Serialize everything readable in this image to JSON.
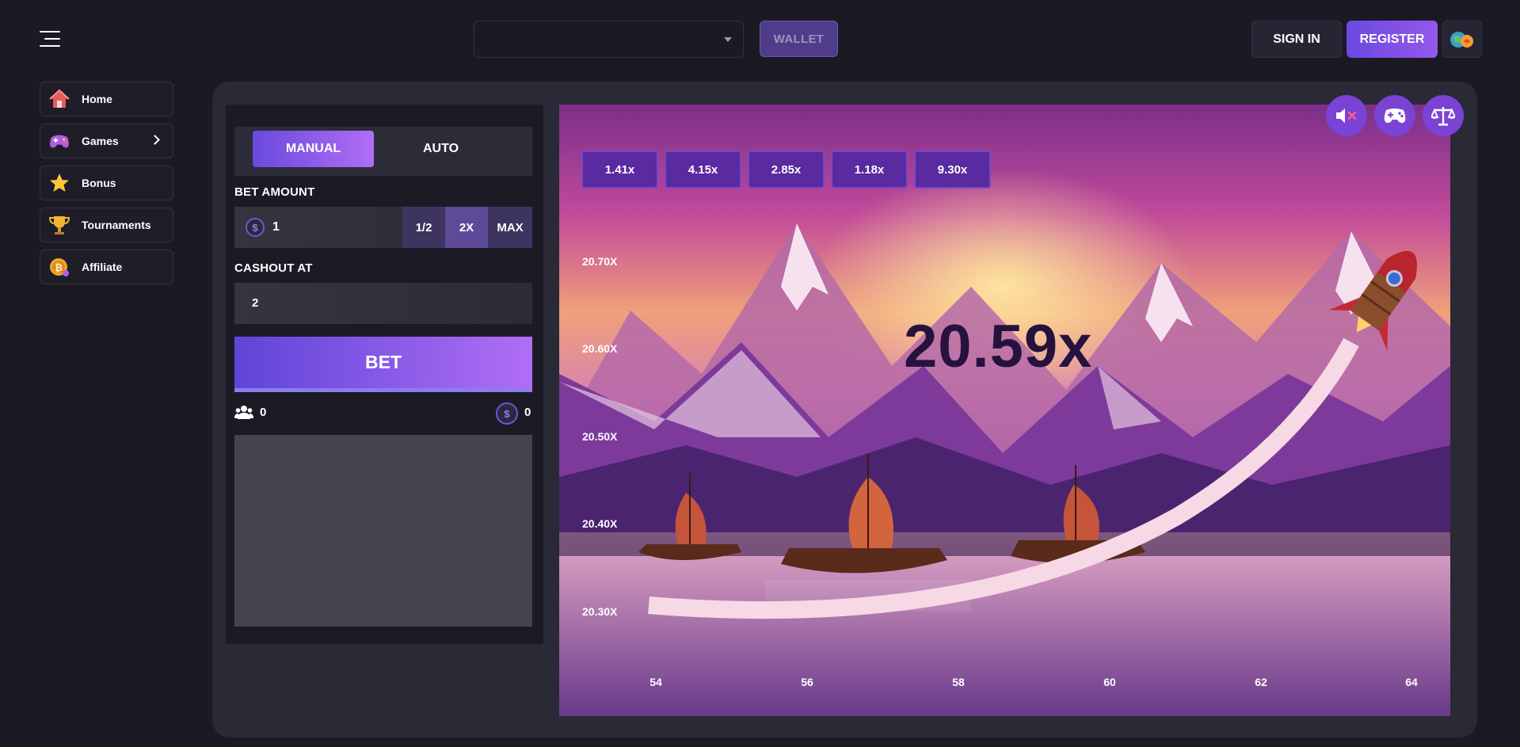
{
  "header": {
    "currency_value": "",
    "wallet_label": "WALLET",
    "signin_label": "SIGN IN",
    "register_label": "REGISTER"
  },
  "sidebar": {
    "items": [
      {
        "label": "Home",
        "icon": "house-icon"
      },
      {
        "label": "Games",
        "icon": "gamepad-icon"
      },
      {
        "label": "Bonus",
        "icon": "star-icon"
      },
      {
        "label": "Tournaments",
        "icon": "trophy-icon"
      },
      {
        "label": "Affiliate",
        "icon": "coin-icon"
      }
    ]
  },
  "bet_panel": {
    "modes": [
      "MANUAL",
      "AUTO"
    ],
    "active_mode": "MANUAL",
    "bet_amount_label": "BET AMOUNT",
    "bet_amount": "1",
    "currency_symbol": "$",
    "half_label": "1/2",
    "double_label": "2X",
    "max_label": "MAX",
    "cashout_label": "CASHOUT AT",
    "cashout_value": "2",
    "bet_button": "BET",
    "players_count": "0",
    "pot_total": "0"
  },
  "game": {
    "history": [
      "1.41x",
      "4.15x",
      "2.85x",
      "1.18x",
      "9.30x"
    ],
    "current_multiplier": "20.59x",
    "y_axis": [
      "20.70X",
      "20.60X",
      "20.50X",
      "20.40X",
      "20.30X"
    ],
    "x_axis": [
      "54",
      "56",
      "58",
      "60",
      "62",
      "64"
    ]
  },
  "colors": {
    "accent": "#7b42d6",
    "register_gradient_start": "#6b49e0",
    "register_gradient_end": "#9458ec",
    "curve": "#f7d9e6"
  }
}
